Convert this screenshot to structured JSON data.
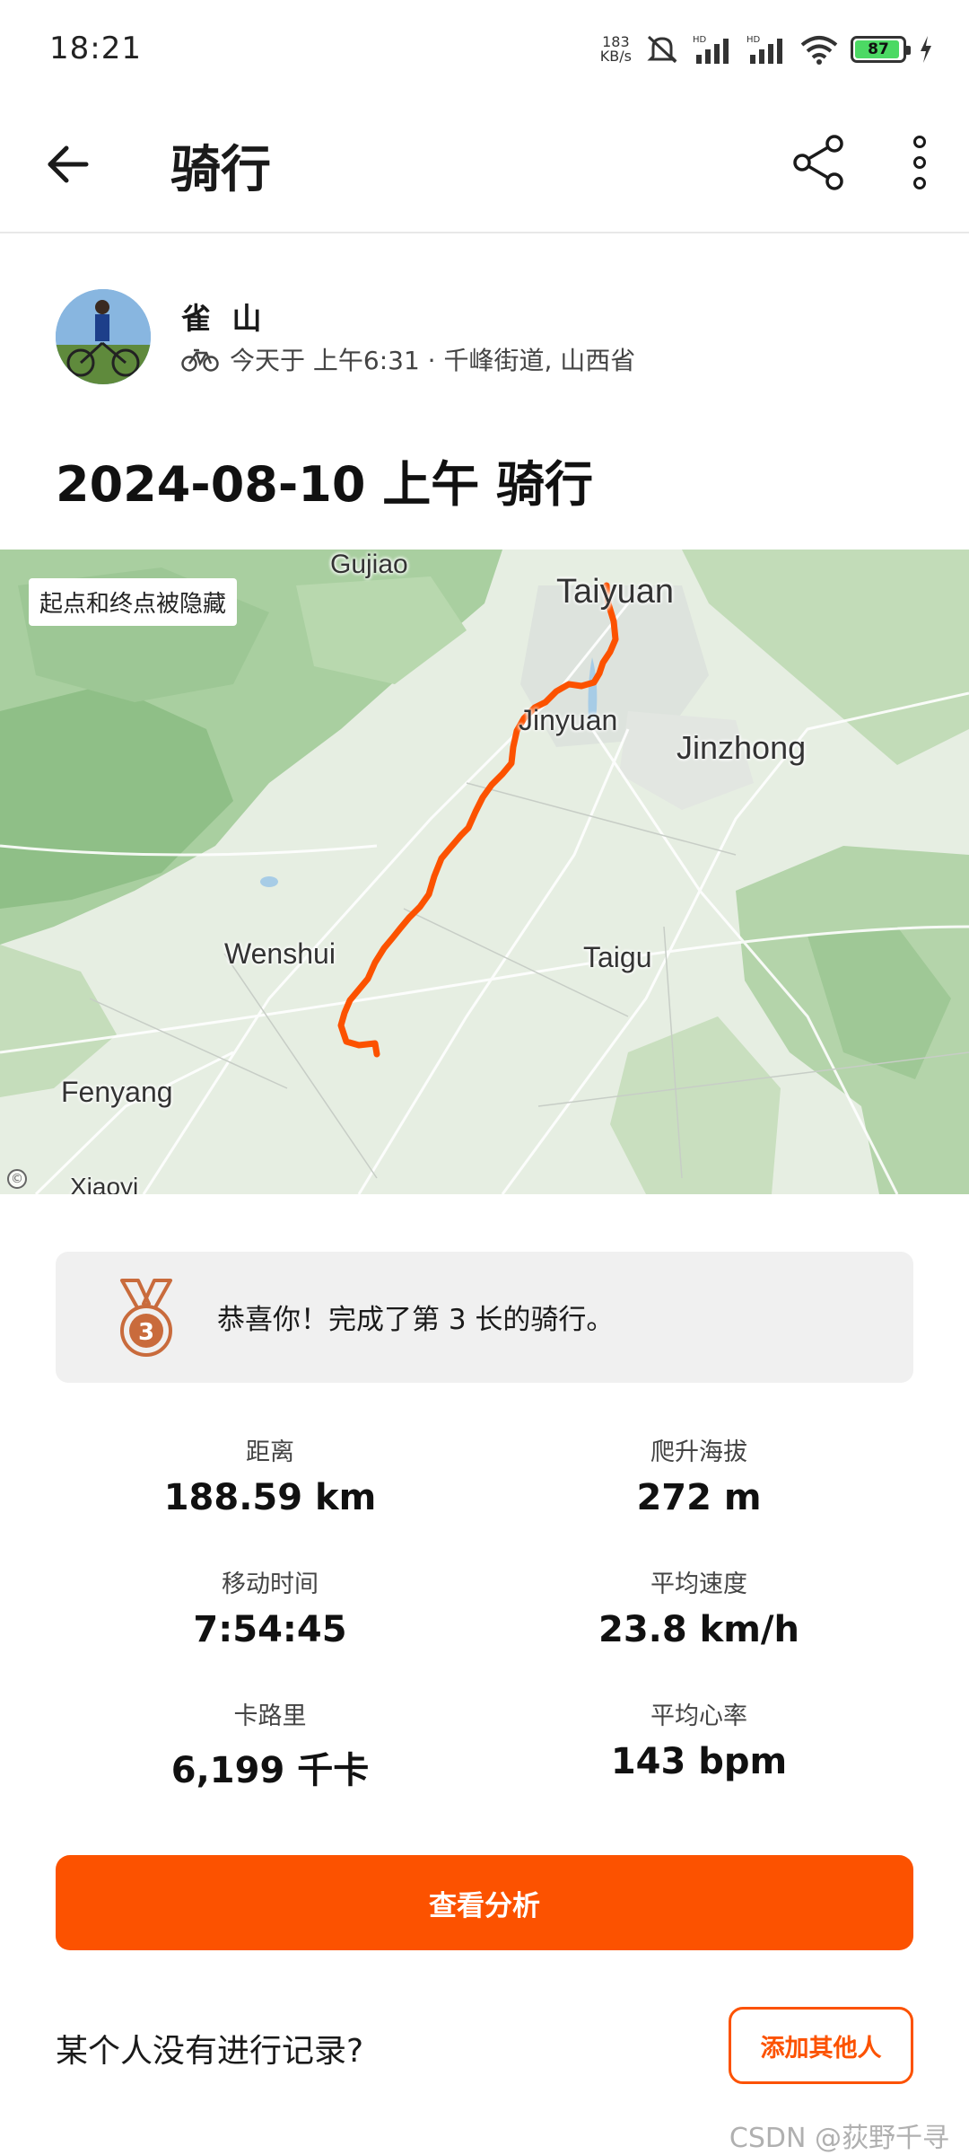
{
  "status_bar": {
    "time": "18:21",
    "net_speed_value": "183",
    "net_speed_unit": "KB/s",
    "battery_level": "87",
    "icons": [
      "mute-icon",
      "hd-signal-icon",
      "hd-signal-icon",
      "wifi-icon",
      "battery-icon",
      "charging-icon"
    ]
  },
  "header": {
    "title": "骑行",
    "back_icon": "arrow-left-icon",
    "share_icon": "share-icon",
    "more_icon": "more-vertical-icon"
  },
  "athlete": {
    "name": "雀 山",
    "activity_icon": "bike-icon",
    "meta": "今天于 上午6:31 · 千峰街道, 山西省"
  },
  "activity_title": "2024-08-10 上午 骑行",
  "map": {
    "privacy_badge": "起点和终点被隐藏",
    "route_color": "#fc5200",
    "labels": {
      "gujiao": "Gujiao",
      "taiyuan": "Taiyuan",
      "jinyuan": "Jinyuan",
      "jinzhong": "Jinzhong",
      "wenshui": "Wenshui",
      "taigu": "Taigu",
      "fenyang": "Fenyang",
      "xiaoyi": "Xiaoyi"
    }
  },
  "achievement": {
    "rank": "3",
    "text": "恭喜你！完成了第 3 长的骑行。",
    "medal_color": "#c96b3c"
  },
  "stats": [
    {
      "label": "距离",
      "value": "188.59 km"
    },
    {
      "label": "爬升海拔",
      "value": "272 m"
    },
    {
      "label": "移动时间",
      "value": "7:54:45"
    },
    {
      "label": "平均速度",
      "value": "23.8 km/h"
    },
    {
      "label": "卡路里",
      "value": "6,199 千卡"
    },
    {
      "label": "平均心率",
      "value": "143 bpm"
    }
  ],
  "actions": {
    "analyze_label": "查看分析",
    "missing_prompt": "某个人没有进行记录?",
    "add_others_label": "添加其他人"
  },
  "brand_color": "#fc5200",
  "watermark": "CSDN @荻野千寻"
}
